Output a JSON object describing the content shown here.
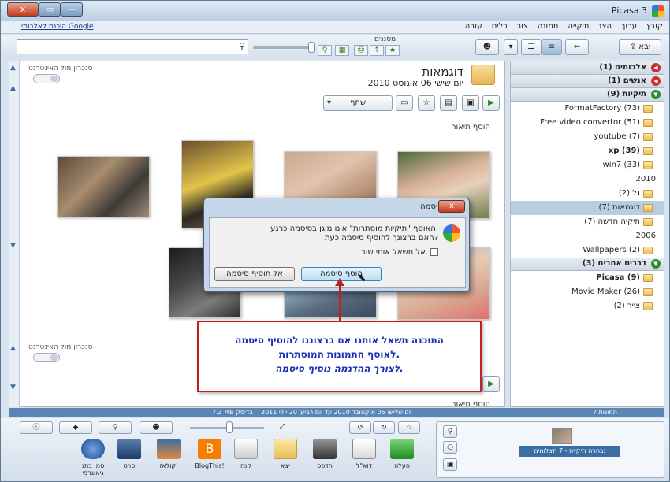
{
  "window": {
    "title": "Picasa 3",
    "close_label": "x",
    "max_label": "▭",
    "min_label": "—"
  },
  "menubar": {
    "items": [
      "קובץ",
      "ערוך",
      "הצג",
      "תיקייה",
      "תמונה",
      "צור",
      "כלים",
      "עזרה"
    ],
    "google_signin": "היכנס לאלבומי Google"
  },
  "toolbar": {
    "import_label": "יבא",
    "filters_label": "מסננים",
    "search_placeholder": ""
  },
  "album": {
    "title": "דוגמאות",
    "date": "יום שישי 06 אוגוסט 2010",
    "sync_label": "סנכרון מול האינטרנט",
    "share_label": "שתף",
    "add_description": "הוסף תיאור"
  },
  "album2": {
    "sync_label": "סנכרון מול האינטרנט",
    "add_description": "הוסף תיאור"
  },
  "sidebar": {
    "sections": {
      "albums": "אלבומים (1)",
      "people": "אנשים (1)",
      "folders": "תיקיות (9)",
      "other": "דברים אחרים (3)"
    },
    "folders": [
      {
        "label": "FormatFactory (73)",
        "bold": false
      },
      {
        "label": "Free video convertor (51)",
        "bold": false
      },
      {
        "label": "youtube (7)",
        "bold": false
      },
      {
        "label": "xp (39)",
        "bold": true
      },
      {
        "label": "win7 (33)",
        "bold": false
      }
    ],
    "year_2010": "2010",
    "folders_2010": [
      {
        "label": "גל (2)",
        "selected": false
      },
      {
        "label": "דוגמאות (7)",
        "selected": true
      },
      {
        "label": "תיקיה חדשה (7)",
        "selected": false
      }
    ],
    "year_2006": "2006",
    "folders_2006": [
      {
        "label": "Wallpapers (2)"
      }
    ],
    "other_items": [
      {
        "label": "Picasa (9)",
        "bold": true
      },
      {
        "label": "Movie Maker (26)",
        "bold": false
      },
      {
        "label": "צייר (2)",
        "bold": false
      }
    ]
  },
  "status": {
    "count": "7 תמונות",
    "dates": "יום שלישי 05 אוקטובר 2010 עד יום רביעי 20 יולי 2011",
    "size": "7.3 MB בדיסק"
  },
  "tray": {
    "selection_label": "נבחרה תיקייה - 7 תצלומים",
    "actions": [
      "העלה",
      "דוא\"ל",
      "הדפס",
      "יצא",
      "קנה",
      "BlogThis!",
      "קולאז'",
      "סרט",
      "סמן בתג גיאוגרפי"
    ]
  },
  "dialog": {
    "title": "הוסף סיסמה",
    "line1": "האוסף \"תיקיות מוסתרות\" אינו מוגן בסיסמה כרגע.",
    "line2": "האם ברצונך להוסיף סיסמה כעת?",
    "checkbox_label": "אל תשאל אותי שוב.",
    "ok_label": "הוסף סיסמה",
    "cancel_label": "אל תוסיף סיסמה",
    "close_label": "x"
  },
  "callout": {
    "line1": "התוכנה תשאל אותנו אם ברצוננו להוסיף סיסמה",
    "line2": "לאוסף התמונות המוסתרות.",
    "line3": "לצורך ההדגמה נוסיף סיסמה."
  },
  "colors": {
    "accent": "#3a6ea5",
    "callout_border": "#c02020",
    "callout_text": "#1b2fb5"
  }
}
